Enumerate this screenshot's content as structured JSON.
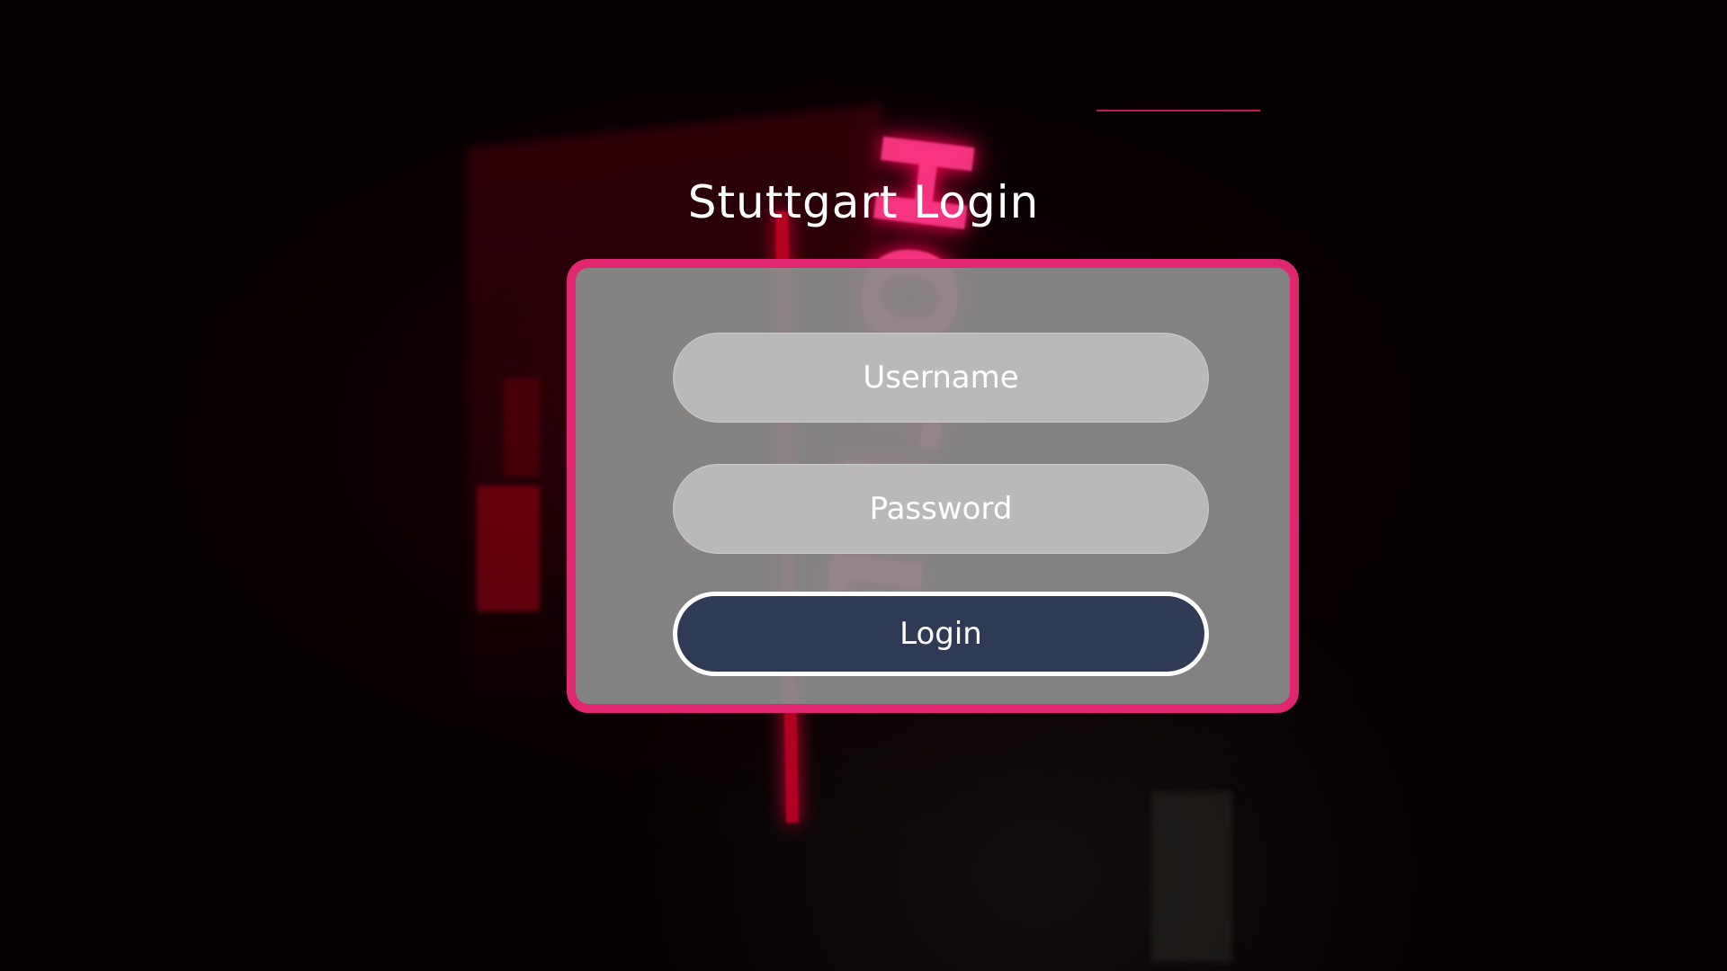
{
  "page": {
    "title": "Stuttgart Login"
  },
  "form": {
    "username_placeholder": "Username",
    "password_placeholder": "Password",
    "submit_label": "Login"
  },
  "background": {
    "sign_text": "HOTEL"
  },
  "colors": {
    "accent": "#e0266f",
    "button_bg": "#2f3a55",
    "card_bg": "#8c8c8c",
    "text": "#ffffff"
  }
}
